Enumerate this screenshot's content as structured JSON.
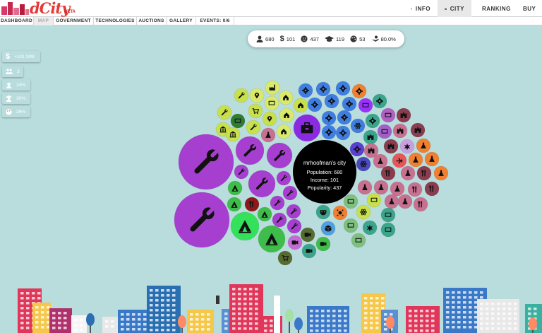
{
  "header": {
    "logo_text": "dCity",
    "logo_badge": "BETA",
    "nav": [
      {
        "label": "INFO",
        "icon": "info-icon",
        "active": false
      },
      {
        "label": "CITY",
        "icon": "city-icon",
        "active": true
      },
      {
        "label": "RANKING",
        "icon": "trophy-icon",
        "active": false
      },
      {
        "label": "BUY",
        "icon": "cart-icon",
        "active": false
      }
    ]
  },
  "subnav": [
    {
      "label": "DASHBOARD"
    },
    {
      "label": "MAP",
      "dim": true
    },
    {
      "label": "GOVERNMENT"
    },
    {
      "label": "TECHNOLOGIES"
    },
    {
      "label": "AUCTIONS"
    },
    {
      "label": "GALLERY"
    },
    {
      "label": "EVENTS: 0/6"
    }
  ],
  "stats": [
    {
      "icon": "population-icon",
      "value": "680"
    },
    {
      "icon": "income-icon",
      "value": "101"
    },
    {
      "icon": "popularity-icon",
      "value": "437"
    },
    {
      "icon": "education-icon",
      "value": "119"
    },
    {
      "icon": "creativity-icon",
      "value": "53"
    },
    {
      "icon": "employment-icon",
      "value": "80.0%"
    }
  ],
  "side_badges": [
    {
      "icon": "dollar-icon",
      "text": "+101 SIM",
      "color": "#3f9a47"
    },
    {
      "icon": "people-icon",
      "text": "3",
      "color": "#f28a1e"
    },
    {
      "icon": "worker-icon",
      "text": "24%",
      "color": "#f28a1e"
    },
    {
      "icon": "graduate-icon",
      "text": "30%",
      "color": "#f28a1e"
    },
    {
      "icon": "palette-icon",
      "text": "26%",
      "color": "#f28a1e"
    }
  ],
  "city": {
    "name": "mrhoofman's city",
    "population": "Population: 680",
    "income": "Income: 101",
    "popularity": "Popularity: 437"
  },
  "colors": {
    "accent": "#e53935",
    "green": "#3f9a47",
    "orange": "#f28a1e",
    "purple": "#a63fcf",
    "center": "#000000"
  }
}
